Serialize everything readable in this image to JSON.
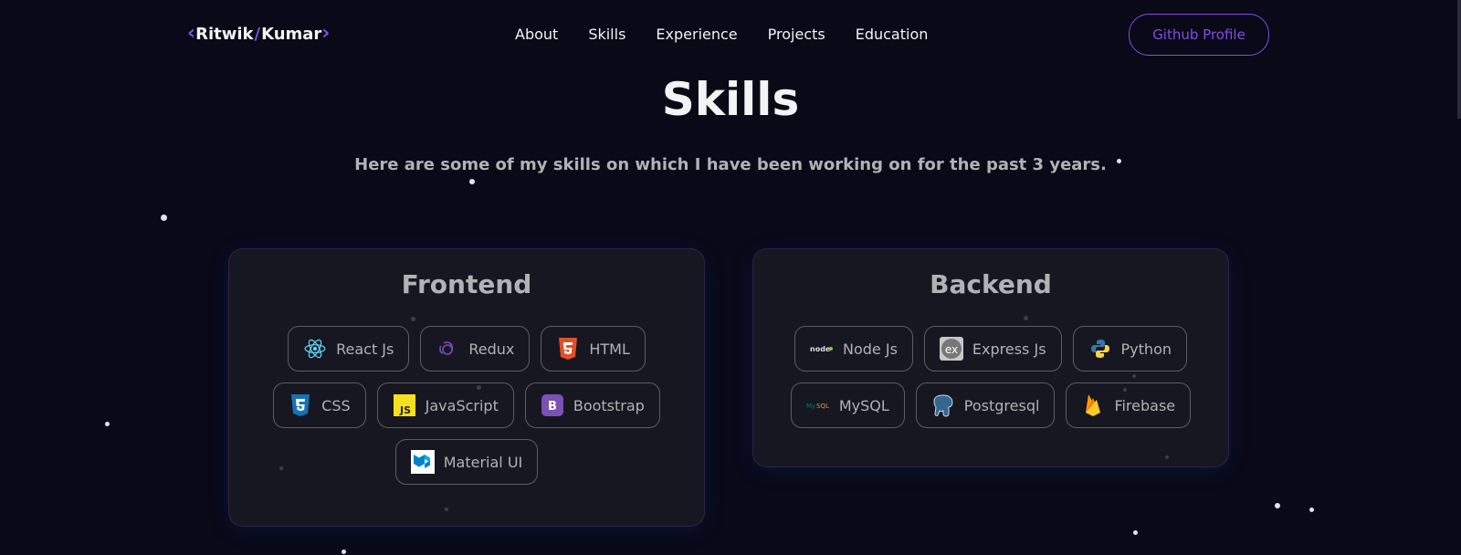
{
  "nav": {
    "logo_left": "Ritwik",
    "logo_slash": "/",
    "logo_right": "Kumar",
    "items": [
      {
        "label": "About"
      },
      {
        "label": "Skills"
      },
      {
        "label": "Experience"
      },
      {
        "label": "Projects"
      },
      {
        "label": "Education"
      }
    ],
    "github_button": "Github Profile"
  },
  "header": {
    "title": "Skills",
    "subtitle": "Here are some of my skills on which I have been working on for the past 3 years."
  },
  "categories": [
    {
      "title": "Frontend",
      "skills": [
        {
          "label": "React Js",
          "icon": "react-icon"
        },
        {
          "label": "Redux",
          "icon": "redux-icon"
        },
        {
          "label": "HTML",
          "icon": "html5-icon"
        },
        {
          "label": "CSS",
          "icon": "css3-icon"
        },
        {
          "label": "JavaScript",
          "icon": "javascript-icon"
        },
        {
          "label": "Bootstrap",
          "icon": "bootstrap-icon"
        },
        {
          "label": "Material UI",
          "icon": "material-ui-icon"
        }
      ]
    },
    {
      "title": "Backend",
      "skills": [
        {
          "label": "Node Js",
          "icon": "nodejs-icon"
        },
        {
          "label": "Express Js",
          "icon": "express-icon"
        },
        {
          "label": "Python",
          "icon": "python-icon"
        },
        {
          "label": "MySQL",
          "icon": "mysql-icon"
        },
        {
          "label": "Postgresql",
          "icon": "postgresql-icon"
        },
        {
          "label": "Firebase",
          "icon": "firebase-icon"
        }
      ]
    }
  ],
  "colors": {
    "background": "#090917",
    "accent": "#854ce6",
    "card": "#171721",
    "text_primary": "#f2f3f4",
    "text_secondary": "#b1b2b3"
  }
}
